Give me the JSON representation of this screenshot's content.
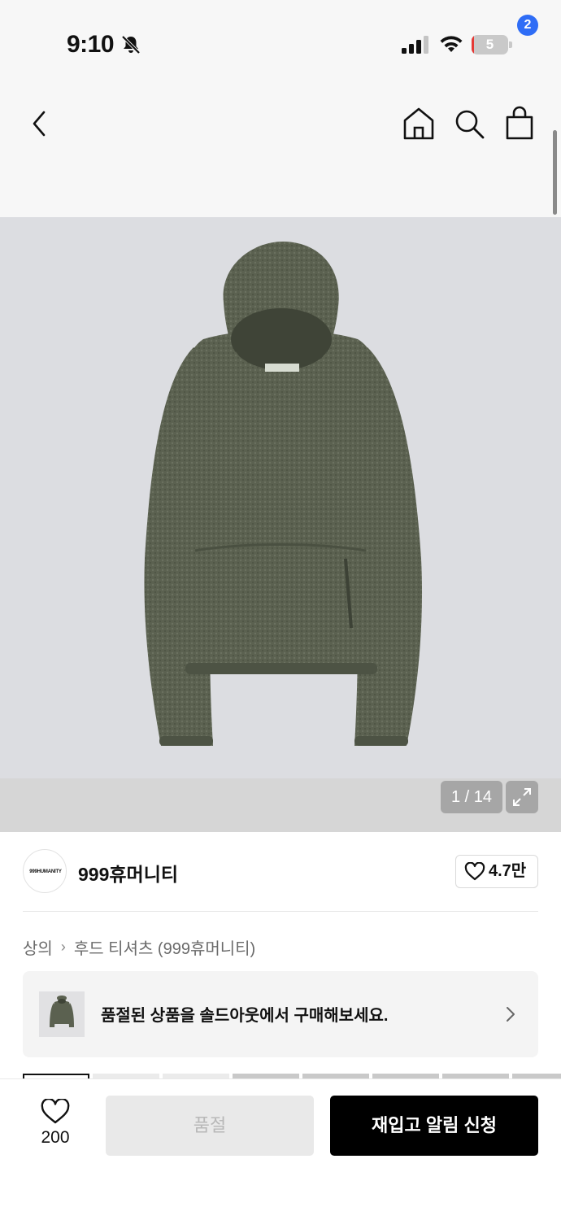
{
  "status_bar": {
    "time": "9:10",
    "battery_level": "5",
    "battery_fraction": 0.05
  },
  "nav": {
    "cart_count": "2"
  },
  "gallery": {
    "counter": "1 / 14"
  },
  "brand": {
    "logo_text": "999HUMANITY",
    "name": "999휴머니티",
    "like_count": "4.7만"
  },
  "breadcrumb": {
    "category": "상의",
    "separator": "›",
    "subcategory": "후드 티셔츠 (999휴머니티)"
  },
  "banner": {
    "text": "품절된 상품을 솔드아웃에서 구매해보세요."
  },
  "bottom_bar": {
    "wish_count": "200",
    "soldout_label": "품절",
    "restock_label": "재입고 알림 신청"
  },
  "colors": {
    "accent_blue": "#2f6df6",
    "battery_low": "#e53935",
    "product_green": "#5b6150"
  },
  "icons": [
    "bell-off-icon",
    "signal-icon",
    "wifi-icon",
    "battery-icon",
    "back-icon",
    "home-icon",
    "search-icon",
    "cart-icon",
    "expand-icon",
    "heart-icon",
    "chevron-right-icon"
  ]
}
